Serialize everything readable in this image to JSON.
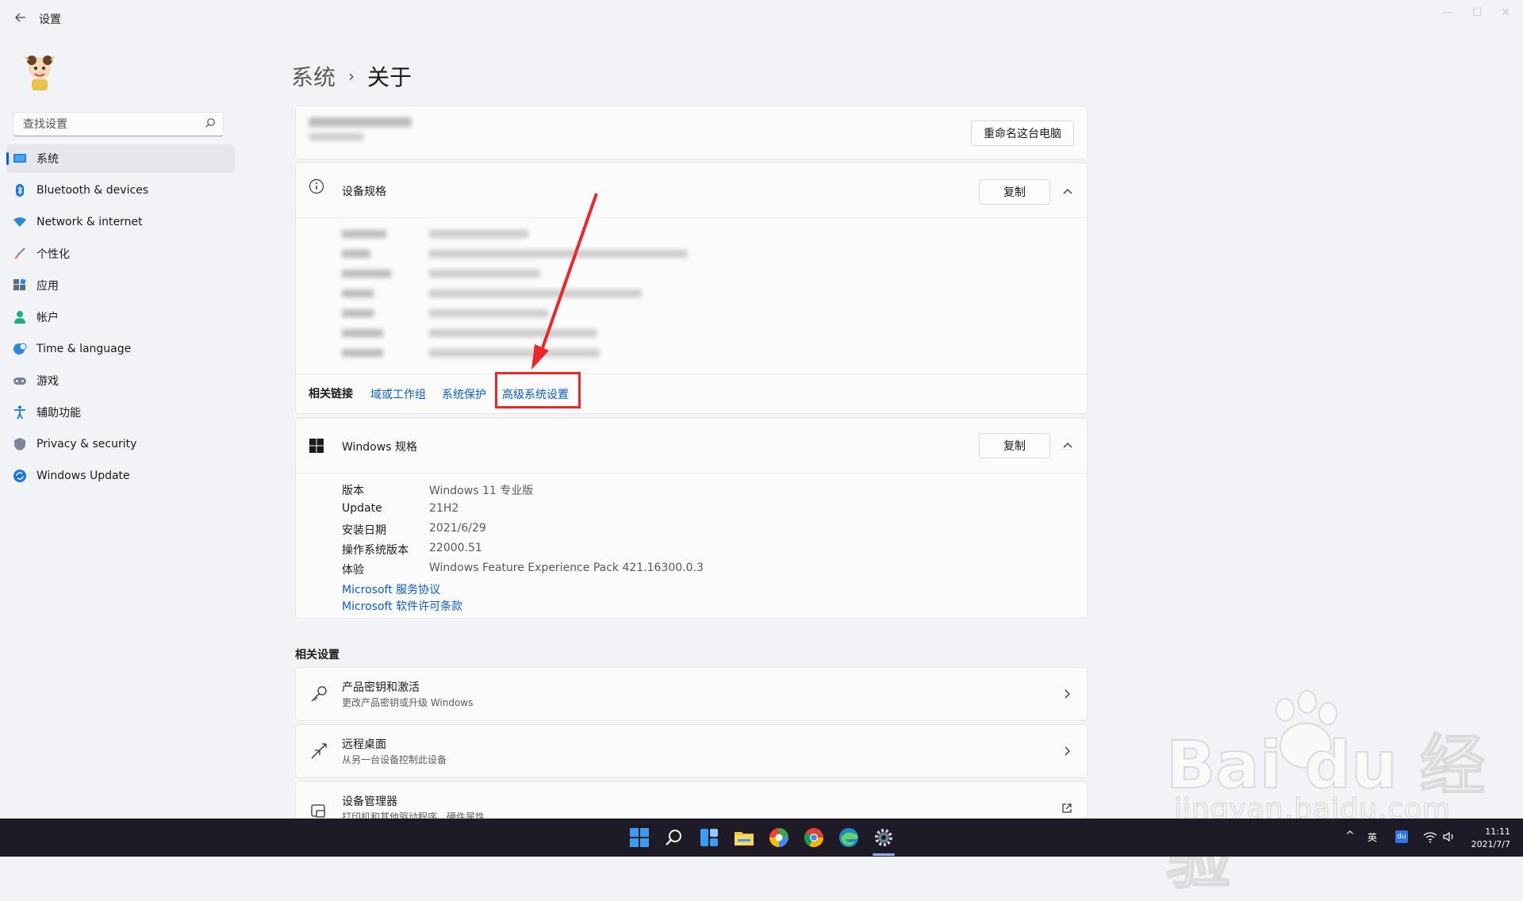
{
  "window": {
    "title": "设置"
  },
  "search": {
    "placeholder": "查找设置"
  },
  "sidebar": {
    "items": [
      {
        "label": "系统",
        "icon": "monitor-icon",
        "active": true
      },
      {
        "label": "Bluetooth & devices",
        "icon": "bluetooth-icon"
      },
      {
        "label": "Network & internet",
        "icon": "wifi-icon"
      },
      {
        "label": "个性化",
        "icon": "brush-icon"
      },
      {
        "label": "应用",
        "icon": "apps-icon"
      },
      {
        "label": "帐户",
        "icon": "person-icon"
      },
      {
        "label": "Time & language",
        "icon": "globe-clock-icon"
      },
      {
        "label": "游戏",
        "icon": "gamepad-icon"
      },
      {
        "label": "辅助功能",
        "icon": "accessibility-icon"
      },
      {
        "label": "Privacy & security",
        "icon": "shield-icon"
      },
      {
        "label": "Windows Update",
        "icon": "update-icon"
      }
    ]
  },
  "breadcrumb": {
    "parent": "系统",
    "separator": "›",
    "current": "关于"
  },
  "device_header": {
    "rename_button": "重命名这台电脑"
  },
  "device_specs": {
    "title": "设备规格",
    "copy_button": "复制",
    "related_links_label": "相关链接",
    "related_links": [
      "域或工作组",
      "系统保护",
      "高级系统设置"
    ]
  },
  "windows_specs": {
    "title": "Windows 规格",
    "copy_button": "复制",
    "rows": [
      {
        "label": "版本",
        "value": "Windows 11 专业版"
      },
      {
        "label": "Update",
        "value": "21H2"
      },
      {
        "label": "安装日期",
        "value": "2021/6/29"
      },
      {
        "label": "操作系统版本",
        "value": "22000.51"
      },
      {
        "label": "体验",
        "value": "Windows Feature Experience Pack 421.16300.0.3"
      }
    ],
    "links": [
      "Microsoft 服务协议",
      "Microsoft 软件许可条款"
    ]
  },
  "related_settings": {
    "title": "相关设置",
    "items": [
      {
        "title": "产品密钥和激活",
        "subtitle": "更改产品密钥或升级 Windows",
        "icon": "key-icon"
      },
      {
        "title": "远程桌面",
        "subtitle": "从另一台设备控制此设备",
        "icon": "remote-desktop-icon"
      },
      {
        "title": "设备管理器",
        "subtitle": "打印机和其他驱动程序、硬件属性",
        "icon": "device-manager-icon"
      }
    ]
  },
  "taskbar": {
    "tray": {
      "ime": "英",
      "time": "11:11",
      "date": "2021/7/7"
    }
  },
  "watermark": {
    "line1": "Bai du 经验",
    "line2": "jingyan.baidu.com"
  },
  "colors": {
    "accent": "#0a5ec7",
    "annotation": "#e8282a",
    "taskbar": "#1e1b27"
  }
}
